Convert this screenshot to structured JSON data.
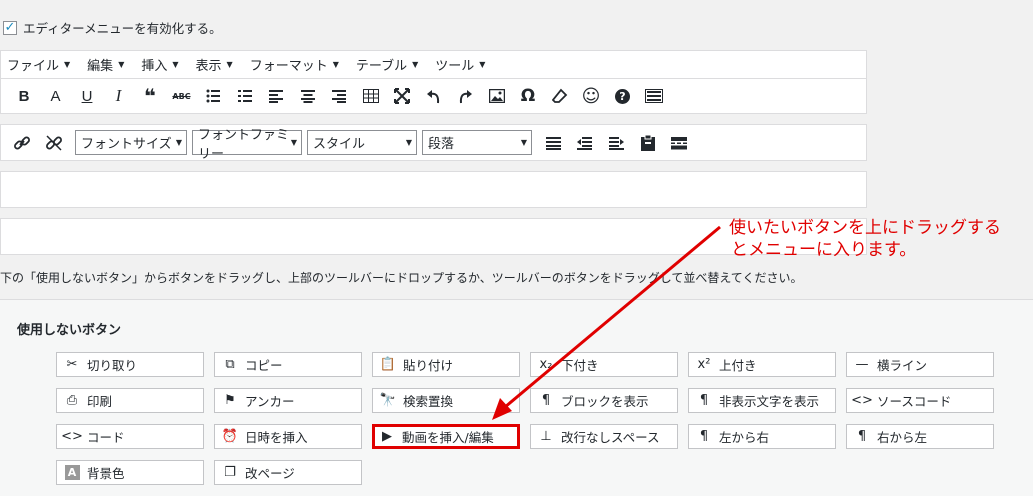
{
  "enable": {
    "checked": true,
    "label": "エディターメニューを有効化する。"
  },
  "menubar": {
    "items": [
      {
        "label": "ファイル"
      },
      {
        "label": "編集"
      },
      {
        "label": "挿入"
      },
      {
        "label": "表示"
      },
      {
        "label": "フォーマット"
      },
      {
        "label": "テーブル"
      },
      {
        "label": "ツール"
      }
    ]
  },
  "toolbar1": {
    "buttons": [
      {
        "icon": "bold-icon",
        "glyph": "B"
      },
      {
        "icon": "font-a-icon",
        "glyph": "A"
      },
      {
        "icon": "underline-icon",
        "glyph": "U"
      },
      {
        "icon": "italic-icon",
        "glyph": "I"
      },
      {
        "icon": "blockquote-icon",
        "glyph": "❝"
      },
      {
        "icon": "strikethrough-icon",
        "glyph": "ABC"
      },
      {
        "icon": "bullet-list-icon",
        "glyph": "☰"
      },
      {
        "icon": "numbered-list-icon",
        "glyph": "☰"
      },
      {
        "icon": "align-left-icon",
        "glyph": "≡"
      },
      {
        "icon": "align-center-icon",
        "glyph": "≡"
      },
      {
        "icon": "align-right-icon",
        "glyph": "≡"
      },
      {
        "icon": "table-icon",
        "glyph": "▦"
      },
      {
        "icon": "fullscreen-icon",
        "glyph": "⤧"
      },
      {
        "icon": "undo-icon",
        "glyph": "↶"
      },
      {
        "icon": "redo-icon",
        "glyph": "↷"
      },
      {
        "icon": "image-icon",
        "glyph": "▣"
      },
      {
        "icon": "omega-icon",
        "glyph": "Ω"
      },
      {
        "icon": "eraser-icon",
        "glyph": "◇"
      },
      {
        "icon": "emoticon-icon",
        "glyph": "☺"
      },
      {
        "icon": "help-icon",
        "glyph": "?"
      },
      {
        "icon": "keyboard-icon",
        "glyph": "⌨"
      }
    ]
  },
  "toolbar2": {
    "link_icon": "link-icon",
    "unlink_icon": "unlink-icon",
    "selects": {
      "font_size": "フォントサイズ",
      "font_family": "フォントファミリー",
      "style": "スタイル",
      "paragraph": "段落"
    },
    "trailing_icons": [
      "justify-icon",
      "outdent-icon",
      "indent-icon",
      "paste-icon",
      "more-tag-icon"
    ]
  },
  "help_text": "下の「使用しないボタン」からボタンをドラッグし、上部のツールバーにドロップするか、ツールバーのボタンをドラッグして並べ替えてください。",
  "annotation": {
    "line1": "使いたいボタンを上にドラッグする",
    "line2": "とメニューに入ります。",
    "color": "#e00000"
  },
  "unused": {
    "title": "使用しないボタン",
    "buttons": [
      {
        "icon": "scissors-icon",
        "glyph": "✂",
        "label": "切り取り"
      },
      {
        "icon": "copy-icon",
        "glyph": "⧉",
        "label": "コピー"
      },
      {
        "icon": "paste-icon",
        "glyph": "📋",
        "label": "貼り付け"
      },
      {
        "icon": "subscript-icon",
        "glyph": "x₂",
        "label": "下付き"
      },
      {
        "icon": "superscript-icon",
        "glyph": "x²",
        "label": "上付き"
      },
      {
        "icon": "horizontal-line-icon",
        "glyph": "—",
        "label": "横ライン"
      },
      {
        "icon": "print-icon",
        "glyph": "⎙",
        "label": "印刷"
      },
      {
        "icon": "anchor-icon",
        "glyph": "⚑",
        "label": "アンカー"
      },
      {
        "icon": "search-replace-icon",
        "glyph": "🔭",
        "label": "検索置換"
      },
      {
        "icon": "pilcrow-icon",
        "glyph": "¶",
        "label": "ブロックを表示"
      },
      {
        "icon": "pilcrow-icon",
        "glyph": "¶",
        "label": "非表示文字を表示"
      },
      {
        "icon": "source-code-icon",
        "glyph": "<>",
        "label": "ソースコード"
      },
      {
        "icon": "code-icon",
        "glyph": "<>",
        "label": "コード"
      },
      {
        "icon": "clock-icon",
        "glyph": "⏰",
        "label": "日時を挿入"
      },
      {
        "icon": "video-icon",
        "glyph": "▶",
        "label": "動画を挿入/編集"
      },
      {
        "icon": "nonbreaking-space-icon",
        "glyph": "⊥",
        "label": "改行なしスペース"
      },
      {
        "icon": "ltr-icon",
        "glyph": "¶",
        "label": "左から右"
      },
      {
        "icon": "rtl-icon",
        "glyph": "¶",
        "label": "右から左"
      },
      {
        "icon": "background-color-icon",
        "glyph": "A",
        "label": "背景色"
      },
      {
        "icon": "page-break-icon",
        "glyph": "❐",
        "label": "改ページ"
      }
    ],
    "highlight_color": "#e00000"
  }
}
